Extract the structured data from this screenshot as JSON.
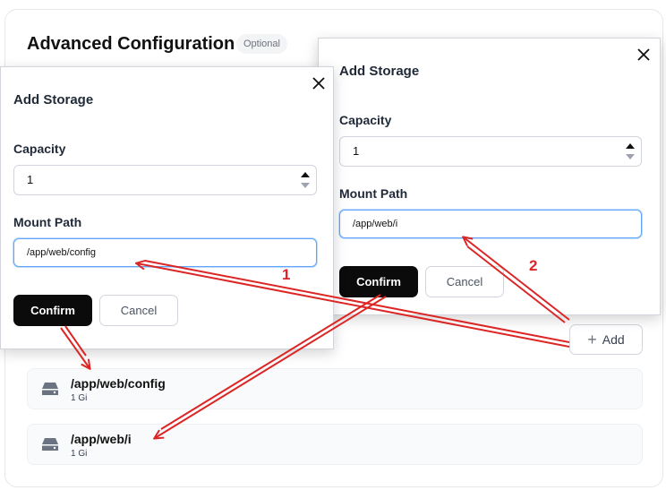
{
  "section": {
    "title": "Advanced Configuration",
    "badge": "Optional",
    "add_button_label": "Add"
  },
  "storage_list": [
    {
      "path": "/app/web/config",
      "size": "1 Gi",
      "icon": "drive-icon"
    },
    {
      "path": "/app/web/i",
      "size": "1 Gi",
      "icon": "drive-icon"
    }
  ],
  "dialog_left": {
    "title": "Add Storage",
    "capacity_label": "Capacity",
    "capacity_value": "1",
    "mount_label": "Mount Path",
    "mount_value": "/app/web/config",
    "confirm_label": "Confirm",
    "cancel_label": "Cancel"
  },
  "dialog_right": {
    "title": "Add Storage",
    "capacity_label": "Capacity",
    "capacity_value": "1",
    "mount_label": "Mount Path",
    "mount_value": "/app/web/i",
    "confirm_label": "Confirm",
    "cancel_label": "Cancel"
  },
  "annotations": {
    "step_1": "1",
    "step_2": "2",
    "color": "#dc2626"
  }
}
